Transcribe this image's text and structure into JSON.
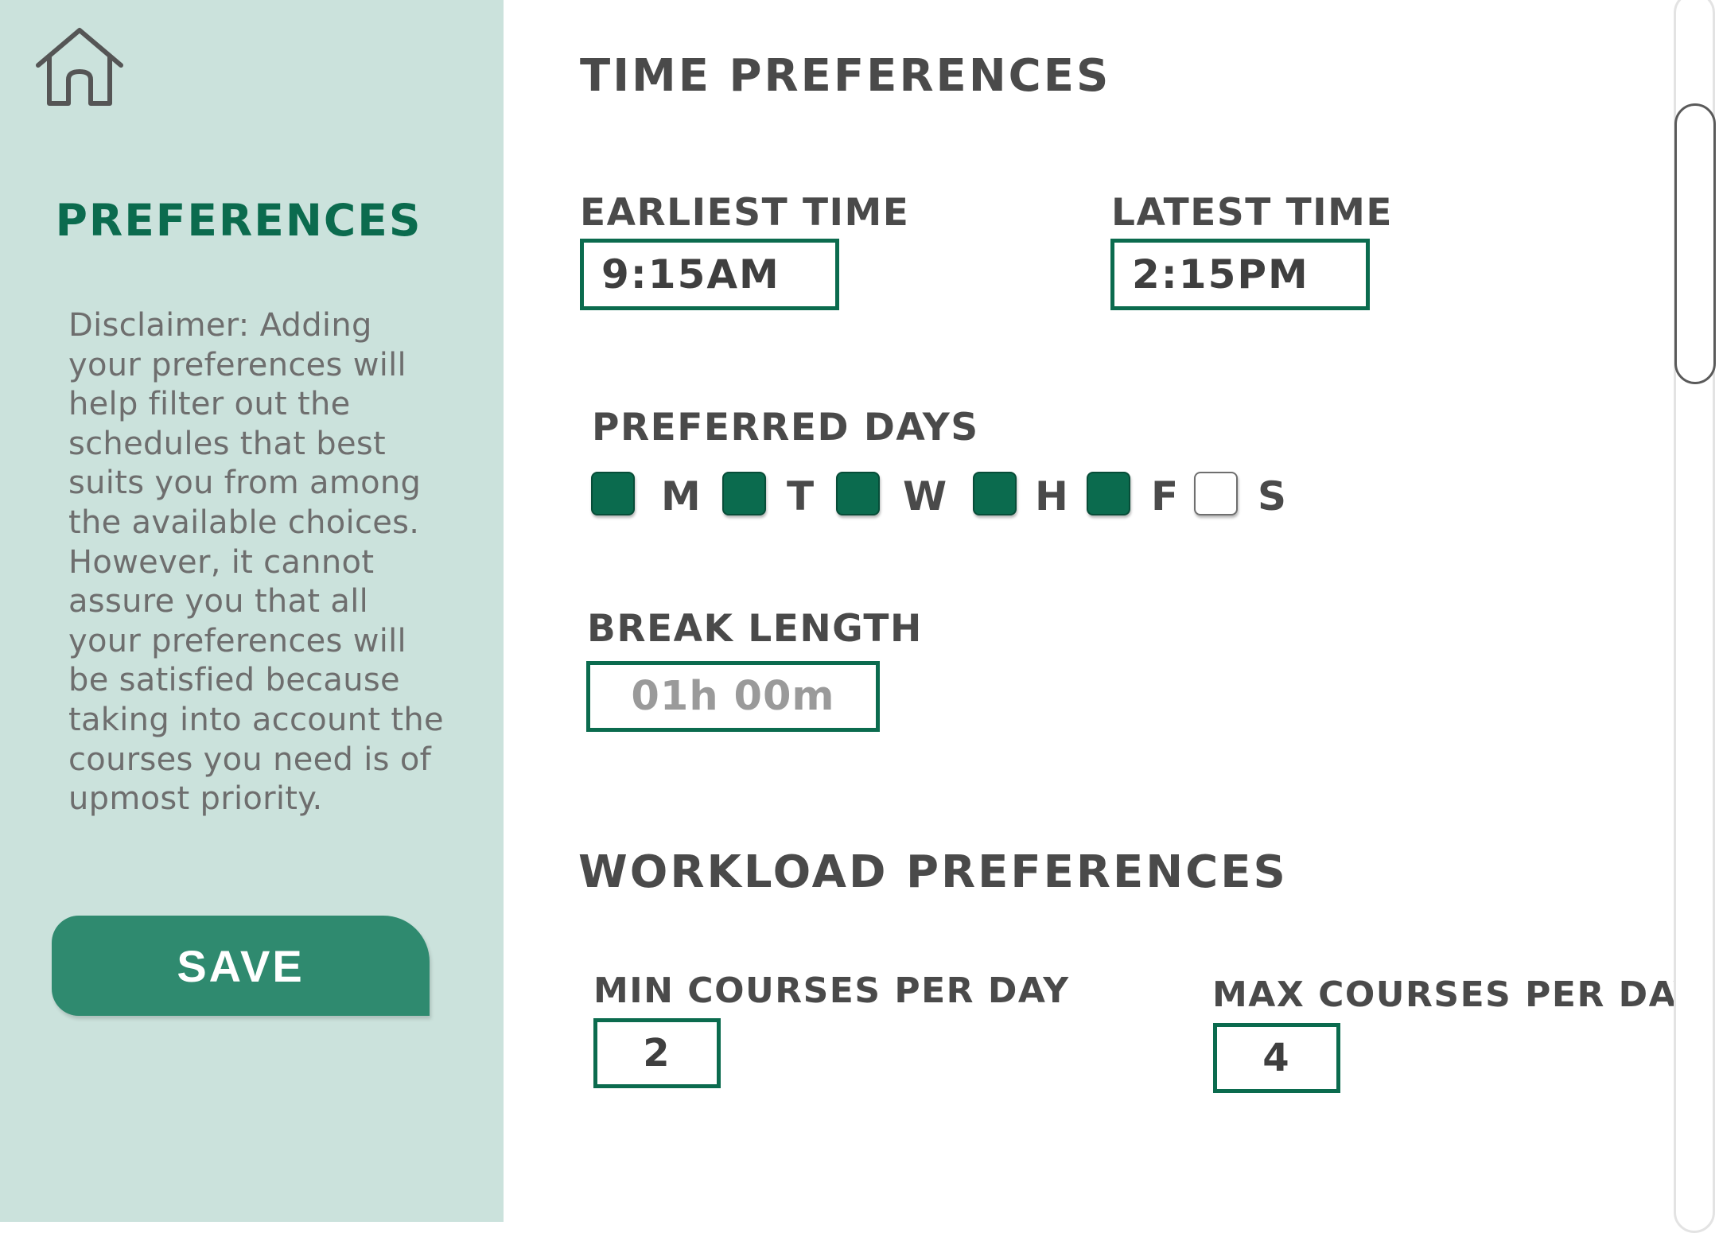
{
  "sidebar": {
    "home_icon": "home-icon",
    "title": "PREFERENCES",
    "disclaimer": "Disclaimer: Adding your preferences will help filter out the schedules that best suits you from among the available choices. However, it cannot assure you that all your preferences will be satisfied because taking into account the courses you need is of upmost priority.",
    "save_label": "SAVE"
  },
  "time_preferences": {
    "title": "TIME PREFERENCES",
    "earliest_label": "EARLIEST TIME",
    "earliest_value": "9:15AM",
    "latest_label": "LATEST TIME",
    "latest_value": "2:15PM",
    "days_label": "PREFERRED DAYS",
    "days": [
      {
        "letter": "M",
        "checked": true
      },
      {
        "letter": "T",
        "checked": true
      },
      {
        "letter": "W",
        "checked": true
      },
      {
        "letter": "H",
        "checked": true
      },
      {
        "letter": "F",
        "checked": true
      },
      {
        "letter": "S",
        "checked": false
      }
    ],
    "break_label": "BREAK LENGTH",
    "break_value": "01h 00m"
  },
  "workload_preferences": {
    "title": "WORKLOAD PREFERENCES",
    "min_label": "MIN COURSES PER DAY",
    "min_value": "2",
    "max_label": "MAX COURSES PER DAY",
    "max_value": "4"
  },
  "colors": {
    "sidebar_bg": "#cbe2dc",
    "accent": "#0b6b4e",
    "save_button": "#2f8a6f",
    "text": "#4a4a4a",
    "placeholder": "#9a9a9a"
  }
}
